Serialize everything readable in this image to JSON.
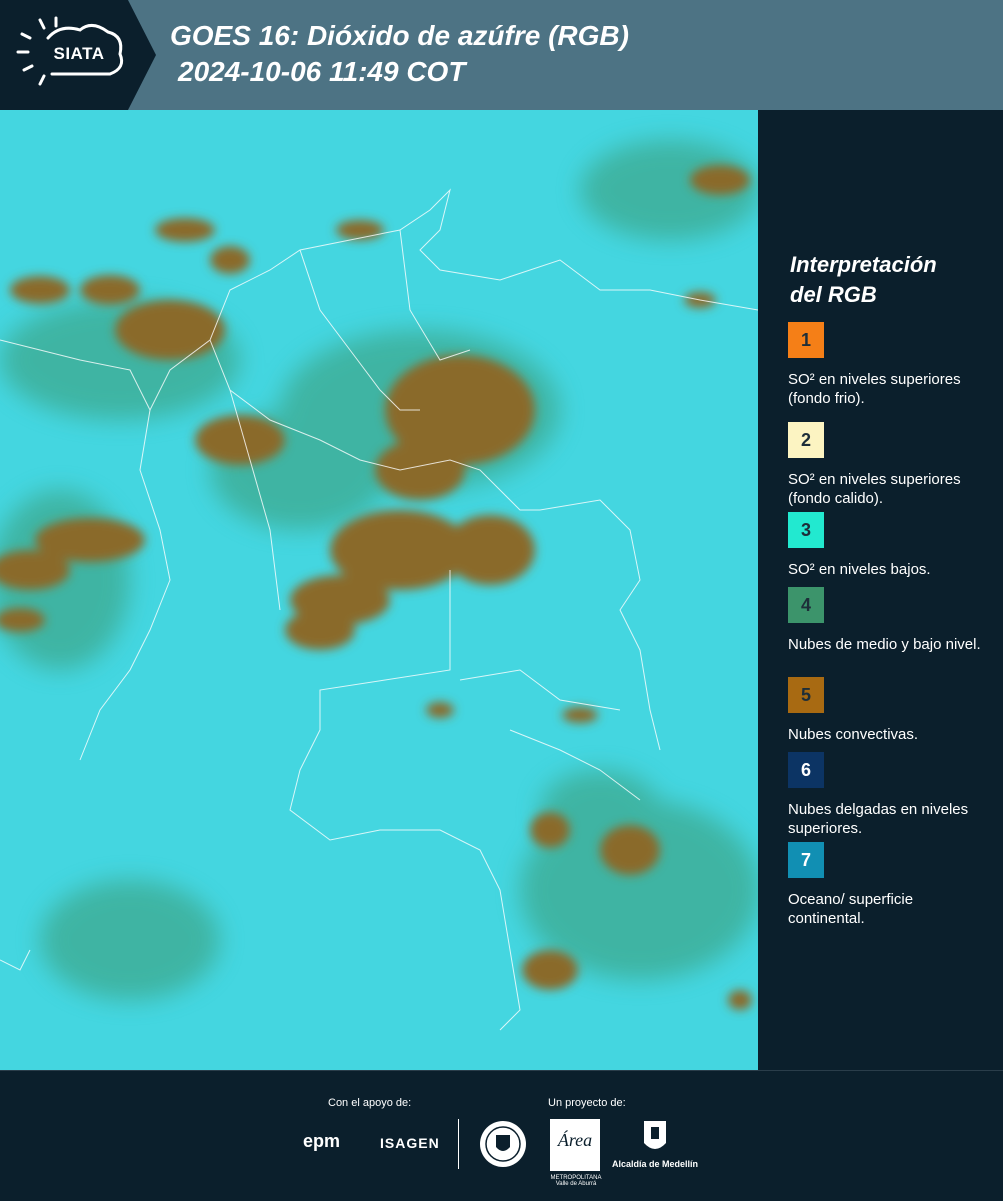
{
  "header": {
    "logo_text": "SIATA",
    "title_line1": "GOES 16: Dióxido de azúfre (RGB)",
    "title_line2": "2024-10-06 11:49 COT"
  },
  "legend": {
    "title_line1": "Interpretación",
    "title_line2": "del RGB",
    "items": [
      {
        "number": "1",
        "color": "#f57f17",
        "text": "SO² en niveles superiores (fondo frio)."
      },
      {
        "number": "2",
        "color": "#fcf4c2",
        "text": "SO² en niveles superiores (fondo calido)."
      },
      {
        "number": "3",
        "color": "#22e9d0",
        "text": "SO² en niveles bajos."
      },
      {
        "number": "4",
        "color": "#3c946b",
        "text": "Nubes de medio y bajo nivel."
      },
      {
        "number": "5",
        "color": "#a86a12",
        "text": "Nubes convectivas."
      },
      {
        "number": "6",
        "color": "#0c3464",
        "text": "Nubes delgadas en niveles superiores."
      },
      {
        "number": "7",
        "color": "#118fb3",
        "text": "Oceano/ superficie continental."
      }
    ]
  },
  "footer": {
    "support_label": "Con el apoyo de:",
    "project_label": "Un proyecto de:",
    "sponsor1": "epm",
    "sponsor2": "ISAGEN",
    "partner1_label": "METROPOLITANA Valle de Aburrá",
    "partner1_logo": "Área",
    "partner2": "Alcaldía de Medellín"
  },
  "map": {
    "background_color": "#3fd3dd",
    "cloud_color": "#8a6a2c",
    "cloud_green": "#3b9a72",
    "border_color": "#ffffff"
  }
}
